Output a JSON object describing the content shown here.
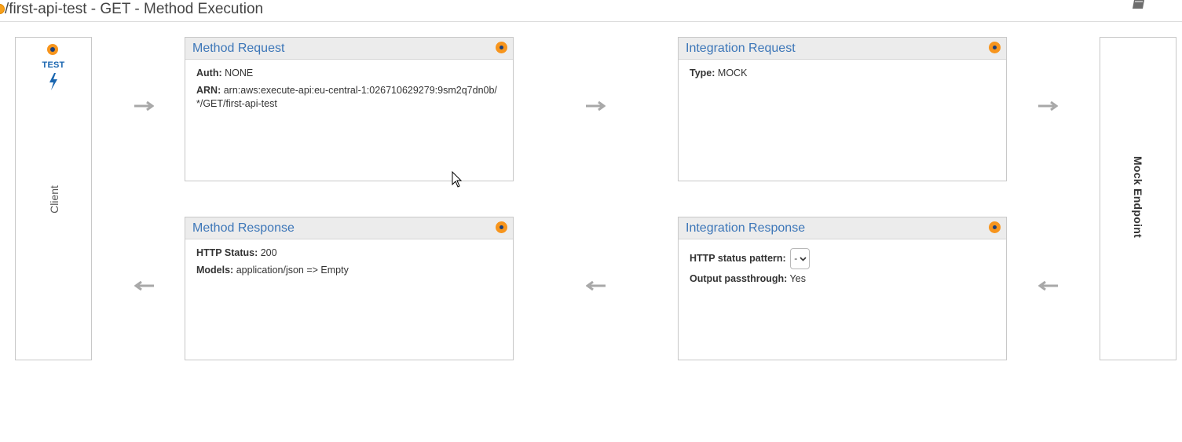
{
  "header": {
    "title": "/first-api-test - GET - Method Execution"
  },
  "client": {
    "test_label": "TEST",
    "label": "Client"
  },
  "endpoint": {
    "label": "Mock Endpoint"
  },
  "method_request": {
    "title": "Method Request",
    "auth_label": "Auth:",
    "auth_value": "NONE",
    "arn_label": "ARN:",
    "arn_value": "arn:aws:execute-api:eu-central-1:026710629279:9sm2q7dn0b/*/GET/first-api-test"
  },
  "integration_request": {
    "title": "Integration Request",
    "type_label": "Type:",
    "type_value": "MOCK"
  },
  "method_response": {
    "title": "Method Response",
    "status_label": "HTTP Status:",
    "status_value": "200",
    "models_label": "Models:",
    "models_value": "application/json => Empty"
  },
  "integration_response": {
    "title": "Integration Response",
    "pattern_label": "HTTP status pattern:",
    "pattern_value": "-",
    "passthrough_label": "Output passthrough:",
    "passthrough_value": "Yes"
  },
  "colors": {
    "accent_orange": "#f7951d",
    "link_blue": "#3c76b8",
    "arrow_gray": "#a8a8a8"
  }
}
